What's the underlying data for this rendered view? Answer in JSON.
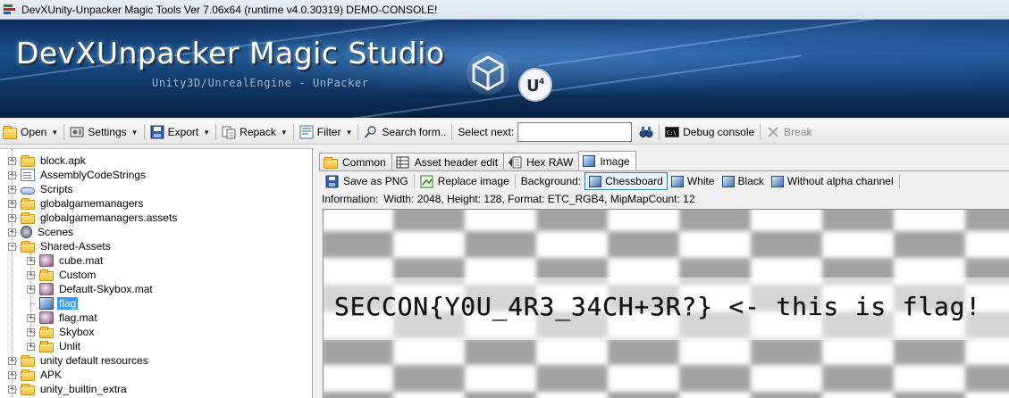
{
  "window": {
    "title": "DevXUnity-Unpacker Magic Tools Ver 7.06x64 (runtime v4.0.30319) DEMO-CONSOLE!"
  },
  "banner": {
    "brand": "DevXUnpacker Magic Studio",
    "subtitle": "Unity3D/UnrealEngine - UnPacker"
  },
  "toolbar": {
    "open_label": "Open",
    "settings_label": "Settings",
    "export_label": "Export",
    "repack_label": "Repack",
    "filter_label": "Filter",
    "search_label": "Search form..",
    "select_next_label": "Select next:",
    "select_next_value": "",
    "debug_label": "Debug console",
    "break_label": "Break"
  },
  "tree": {
    "items": [
      {
        "label": "block.apk",
        "icon": "folder-icon",
        "expandable": true,
        "expanded": false
      },
      {
        "label": "AssemblyCodeStrings",
        "icon": "document-icon",
        "expandable": true,
        "expanded": false
      },
      {
        "label": "Scripts",
        "icon": "script-icon",
        "expandable": true,
        "expanded": false
      },
      {
        "label": "globalgamemanagers",
        "icon": "folder-icon",
        "expandable": true,
        "expanded": false
      },
      {
        "label": "globalgamemanagers.assets",
        "icon": "folder-icon",
        "expandable": true,
        "expanded": false
      },
      {
        "label": "Scenes",
        "icon": "scene-icon",
        "expandable": true,
        "expanded": false
      },
      {
        "label": "Shared-Assets",
        "icon": "folder-icon",
        "expandable": true,
        "expanded": true
      },
      {
        "label": "cube.mat",
        "icon": "material-icon",
        "expandable": true,
        "expanded": false
      },
      {
        "label": "Custom",
        "icon": "folder-icon",
        "expandable": true,
        "expanded": false
      },
      {
        "label": "Default-Skybox.mat",
        "icon": "material-icon",
        "expandable": true,
        "expanded": false
      },
      {
        "label": "flag",
        "icon": "image-icon",
        "expandable": false,
        "selected": true
      },
      {
        "label": "flag.mat",
        "icon": "material-icon",
        "expandable": true,
        "expanded": false
      },
      {
        "label": "Skybox",
        "icon": "folder-icon",
        "expandable": true,
        "expanded": false
      },
      {
        "label": "Unlit",
        "icon": "folder-icon",
        "expandable": true,
        "expanded": false
      },
      {
        "label": "unity default resources",
        "icon": "folder-icon",
        "expandable": true,
        "expanded": false
      },
      {
        "label": "APK",
        "icon": "folder-icon",
        "expandable": true,
        "expanded": false
      },
      {
        "label": "unity_builtin_extra",
        "icon": "folder-icon",
        "expandable": true,
        "expanded": false
      }
    ]
  },
  "tabs": {
    "common": "Common",
    "asset_header": "Asset header edit",
    "hex_raw": "Hex RAW",
    "image": "Image",
    "active": "Image"
  },
  "image_toolbar": {
    "save_png": "Save as PNG",
    "replace_image": "Replace image",
    "background_label": "Background:",
    "chessboard": "Chessboard",
    "white": "White",
    "black": "Black",
    "without_alpha": "Without alpha channel",
    "selected_background": "Chessboard"
  },
  "info": {
    "label": "Information:",
    "text": "Width: 2048, Height: 128, Format: ETC_RGB4, MipMapCount: 12"
  },
  "image_preview": {
    "text": "SECCON{Y0U_4R3_34CH+3R?} <- this is flag!"
  },
  "colors": {
    "selection": "#3399ff",
    "banner_dark": "#0d2e5a",
    "banner_light": "#1a4f8a",
    "chess_dark": "#a3a3a3"
  }
}
